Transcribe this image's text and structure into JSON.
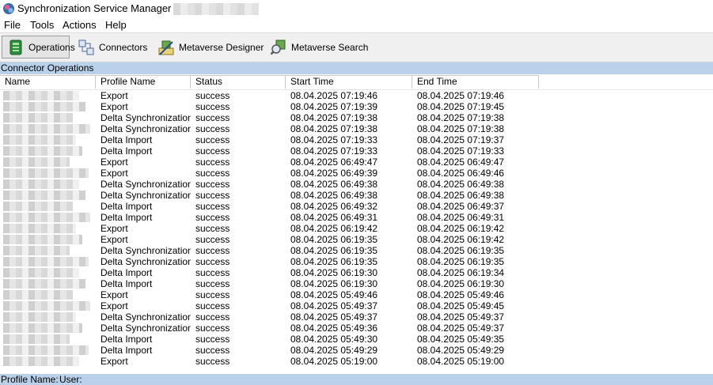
{
  "window": {
    "title": "Synchronization Service Manager on"
  },
  "menu": [
    "File",
    "Tools",
    "Actions",
    "Help"
  ],
  "toolbar": [
    {
      "label": "Operations",
      "icon": "operations-icon",
      "active": true
    },
    {
      "label": "Connectors",
      "icon": "connectors-icon",
      "active": false
    },
    {
      "label": "Metaverse Designer",
      "icon": "metaverse-designer-icon",
      "active": false
    },
    {
      "label": "Metaverse Search",
      "icon": "metaverse-search-icon",
      "active": false
    }
  ],
  "section_title": "Connector Operations",
  "table": {
    "columns": [
      "Name",
      "Profile Name",
      "Status",
      "Start Time",
      "End Time"
    ],
    "rows": [
      {
        "profile": "Export",
        "status": "success",
        "start": "08.04.2025 07:19:46",
        "end": "08.04.2025 07:19:46"
      },
      {
        "profile": "Export",
        "status": "success",
        "start": "08.04.2025 07:19:39",
        "end": "08.04.2025 07:19:45"
      },
      {
        "profile": "Delta Synchronization",
        "status": "success",
        "start": "08.04.2025 07:19:38",
        "end": "08.04.2025 07:19:38"
      },
      {
        "profile": "Delta Synchronization",
        "status": "success",
        "start": "08.04.2025 07:19:38",
        "end": "08.04.2025 07:19:38"
      },
      {
        "profile": "Delta Import",
        "status": "success",
        "start": "08.04.2025 07:19:33",
        "end": "08.04.2025 07:19:37"
      },
      {
        "profile": "Delta Import",
        "status": "success",
        "start": "08.04.2025 07:19:33",
        "end": "08.04.2025 07:19:33"
      },
      {
        "profile": "Export",
        "status": "success",
        "start": "08.04.2025 06:49:47",
        "end": "08.04.2025 06:49:47"
      },
      {
        "profile": "Export",
        "status": "success",
        "start": "08.04.2025 06:49:39",
        "end": "08.04.2025 06:49:46"
      },
      {
        "profile": "Delta Synchronization",
        "status": "success",
        "start": "08.04.2025 06:49:38",
        "end": "08.04.2025 06:49:38"
      },
      {
        "profile": "Delta Synchronization",
        "status": "success",
        "start": "08.04.2025 06:49:38",
        "end": "08.04.2025 06:49:38"
      },
      {
        "profile": "Delta Import",
        "status": "success",
        "start": "08.04.2025 06:49:32",
        "end": "08.04.2025 06:49:37"
      },
      {
        "profile": "Delta Import",
        "status": "success",
        "start": "08.04.2025 06:49:31",
        "end": "08.04.2025 06:49:31"
      },
      {
        "profile": "Export",
        "status": "success",
        "start": "08.04.2025 06:19:42",
        "end": "08.04.2025 06:19:42"
      },
      {
        "profile": "Export",
        "status": "success",
        "start": "08.04.2025 06:19:35",
        "end": "08.04.2025 06:19:42"
      },
      {
        "profile": "Delta Synchronization",
        "status": "success",
        "start": "08.04.2025 06:19:35",
        "end": "08.04.2025 06:19:35"
      },
      {
        "profile": "Delta Synchronization",
        "status": "success",
        "start": "08.04.2025 06:19:35",
        "end": "08.04.2025 06:19:35"
      },
      {
        "profile": "Delta Import",
        "status": "success",
        "start": "08.04.2025 06:19:30",
        "end": "08.04.2025 06:19:34"
      },
      {
        "profile": "Delta Import",
        "status": "success",
        "start": "08.04.2025 06:19:30",
        "end": "08.04.2025 06:19:30"
      },
      {
        "profile": "Export",
        "status": "success",
        "start": "08.04.2025 05:49:46",
        "end": "08.04.2025 05:49:46"
      },
      {
        "profile": "Export",
        "status": "success",
        "start": "08.04.2025 05:49:37",
        "end": "08.04.2025 05:49:45"
      },
      {
        "profile": "Delta Synchronization",
        "status": "success",
        "start": "08.04.2025 05:49:37",
        "end": "08.04.2025 05:49:37"
      },
      {
        "profile": "Delta Synchronization",
        "status": "success",
        "start": "08.04.2025 05:49:36",
        "end": "08.04.2025 05:49:37"
      },
      {
        "profile": "Delta Import",
        "status": "success",
        "start": "08.04.2025 05:49:30",
        "end": "08.04.2025 05:49:35"
      },
      {
        "profile": "Delta Import",
        "status": "success",
        "start": "08.04.2025 05:49:29",
        "end": "08.04.2025 05:49:29"
      },
      {
        "profile": "Export",
        "status": "success",
        "start": "08.04.2025 05:19:00",
        "end": "08.04.2025 05:19:00"
      }
    ]
  },
  "statusbar": {
    "profile_label": "Profile Name:",
    "user_label": "User:"
  }
}
